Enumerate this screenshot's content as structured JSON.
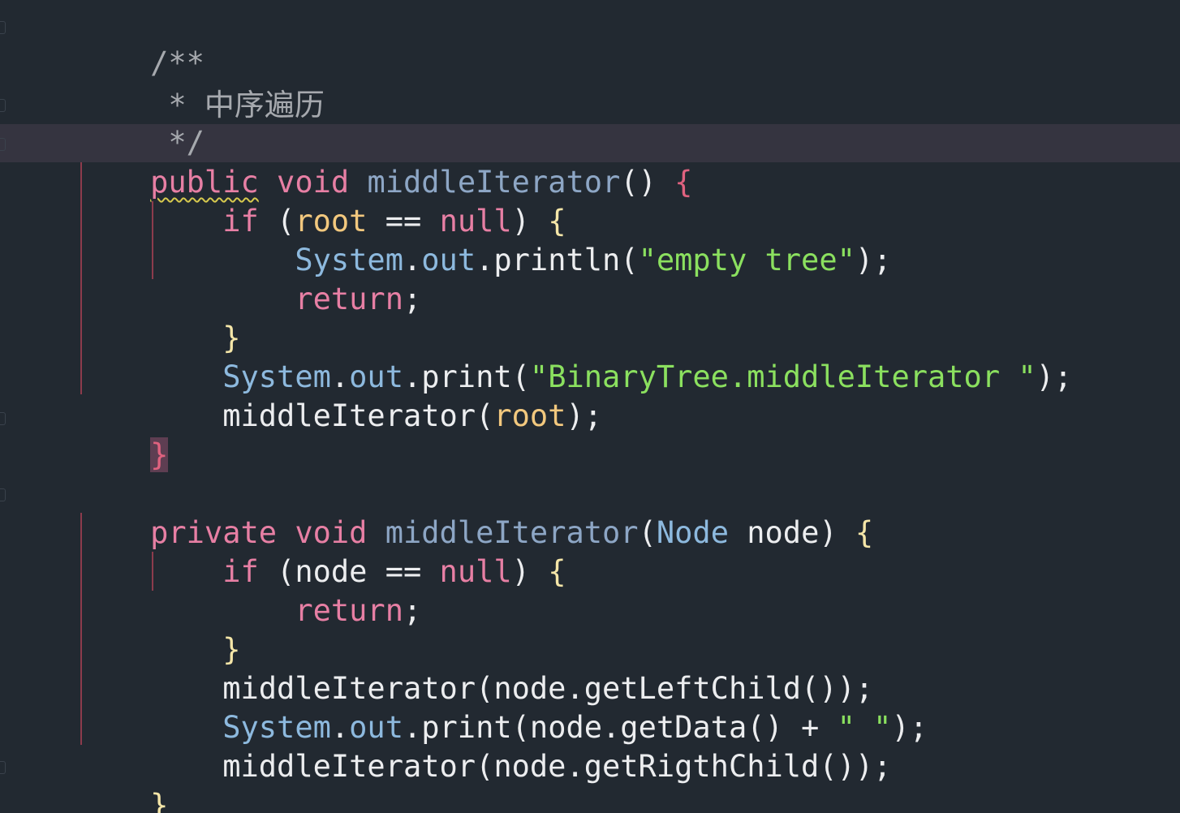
{
  "code": {
    "l0": {
      "t1": "/**"
    },
    "l1": {
      "t1": " * 中序遍历"
    },
    "l2": {
      "t1": " */"
    },
    "l3": {
      "t1": "public",
      "t2": " ",
      "t3": "void",
      "t4": " ",
      "t5": "middleIterator",
      "t6": "() ",
      "t7": "{"
    },
    "l4": {
      "t1": "    ",
      "t2": "if",
      "t3": " (",
      "t4": "root",
      "t5": " == ",
      "t6": "null",
      "t7": ") ",
      "t8": "{"
    },
    "l5": {
      "t1": "        ",
      "t2": "System",
      "t3": ".",
      "t4": "out",
      "t5": ".println(",
      "t6": "\"empty tree\"",
      "t7": ");"
    },
    "l6": {
      "t1": "        ",
      "t2": "return",
      "t3": ";"
    },
    "l7": {
      "t1": "    ",
      "t2": "}"
    },
    "l8": {
      "t1": "    ",
      "t2": "System",
      "t3": ".",
      "t4": "out",
      "t5": ".print(",
      "t6": "\"BinaryTree.middleIterator \"",
      "t7": ");"
    },
    "l9": {
      "t1": "    middleIterator(",
      "t2": "root",
      "t3": ");"
    },
    "l10": {
      "t1": "}"
    },
    "l11": {
      "t1": ""
    },
    "l12": {
      "t1": "private",
      "t2": " ",
      "t3": "void",
      "t4": " ",
      "t5": "middleIterator",
      "t6": "(",
      "t7": "Node",
      "t8": " node) ",
      "t9": "{"
    },
    "l13": {
      "t1": "    ",
      "t2": "if",
      "t3": " (node == ",
      "t4": "null",
      "t5": ") ",
      "t6": "{"
    },
    "l14": {
      "t1": "        ",
      "t2": "return",
      "t3": ";"
    },
    "l15": {
      "t1": "    ",
      "t2": "}"
    },
    "l16": {
      "t1": "    middleIterator(node.getLeftChild());"
    },
    "l17": {
      "t1": "    ",
      "t2": "System",
      "t3": ".",
      "t4": "out",
      "t5": ".print(node.getData() + ",
      "t6": "\" \"",
      "t7": ");"
    },
    "l18": {
      "t1": "    middleIterator(node.getRigthChild());"
    },
    "l19": {
      "t1": "}"
    }
  },
  "colors": {
    "background": "#222931",
    "current_line": "#353440",
    "keyword": "#E77FA4",
    "function": "#8DA6C5",
    "type": "#8DB9DE",
    "string": "#8BE05F",
    "variable": "#F2C87E",
    "comment": "#A6A9AE",
    "indent_guide": "#8C3B4C",
    "warning_squiggle": "#D7C94E"
  }
}
